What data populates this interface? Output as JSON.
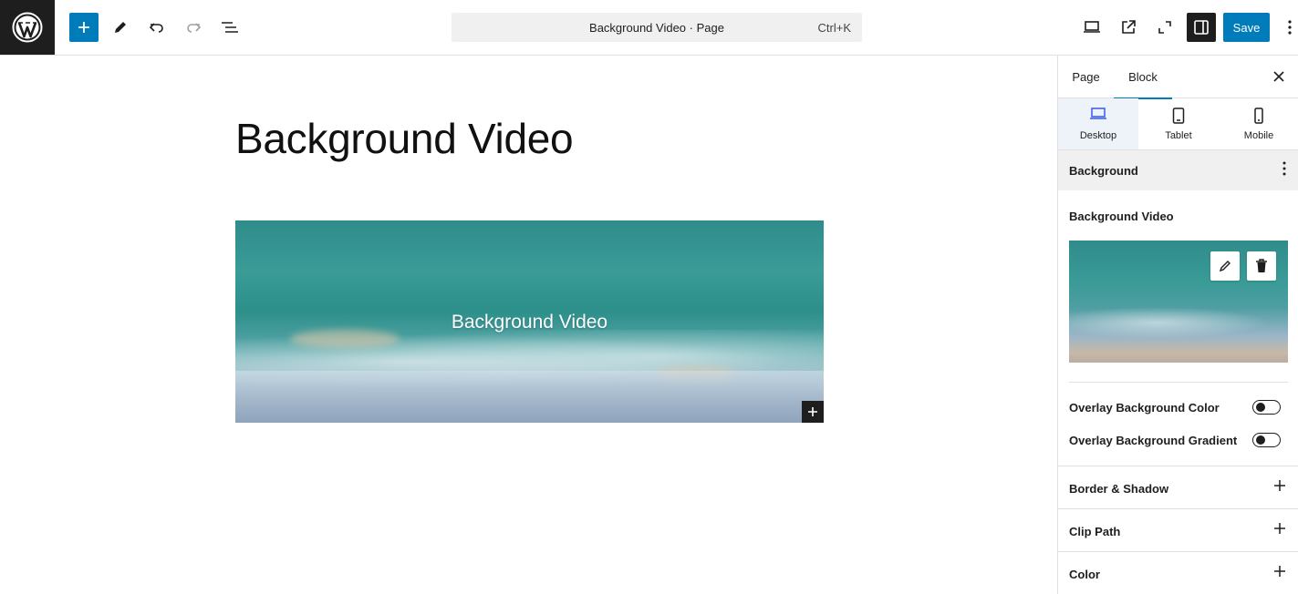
{
  "toolbar": {
    "wp_logo": "wordpress-logo",
    "command_title": "Background Video · Page",
    "command_shortcut": "Ctrl+K",
    "save_label": "Save"
  },
  "canvas": {
    "post_title": "Background Video",
    "video_block_text": "Background Video"
  },
  "sidebar": {
    "tabs": [
      {
        "label": "Page"
      },
      {
        "label": "Block"
      }
    ],
    "active_tab": "Block",
    "devices": [
      {
        "label": "Desktop"
      },
      {
        "label": "Tablet"
      },
      {
        "label": "Mobile"
      }
    ],
    "active_device": "Desktop",
    "background_section": "Background",
    "background_video_label": "Background Video",
    "toggles": [
      {
        "label": "Overlay Background Color",
        "on": false
      },
      {
        "label": "Overlay Background Gradient",
        "on": false
      }
    ],
    "panels": [
      {
        "label": "Border & Shadow"
      },
      {
        "label": "Clip Path"
      },
      {
        "label": "Color"
      }
    ]
  },
  "colors": {
    "accent": "#007cba",
    "dark": "#1e1e1e"
  }
}
